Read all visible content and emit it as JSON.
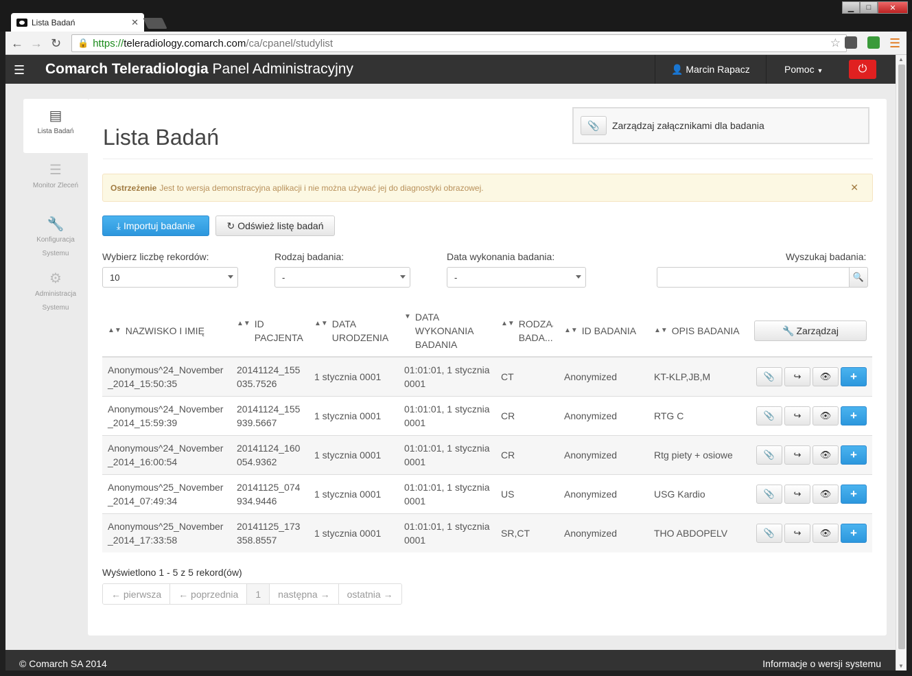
{
  "browser": {
    "tab_title": "Lista Badań",
    "url_protocol": "https://",
    "url_host": "teleradiology.comarch.com",
    "url_path": "/ca/cpanel/studylist"
  },
  "appbar": {
    "brand_bold": "Comarch Teleradiologia",
    "brand_rest": " Panel Administracyjny",
    "user_name": "Marcin Rapacz",
    "help_label": "Pomoc"
  },
  "sidenav": [
    {
      "label": "Lista Badań",
      "icon": "list-icon"
    },
    {
      "label": "Monitor Zleceń",
      "icon": "monitor-icon"
    },
    {
      "label": "Konfiguracja Systemu",
      "icon": "wrench-icon"
    },
    {
      "label": "Administracja Systemu",
      "icon": "gear-icon"
    }
  ],
  "page": {
    "title": "Lista Badań",
    "attach_label": "Zarządzaj załącznikami dla badania",
    "alert_strong": "Ostrzeżenie",
    "alert_text": "Jest to wersja demonstracyjna aplikacji i nie można używać jej do diagnostyki obrazowej.",
    "import_label": "Importuj badanie",
    "refresh_label": "Odśwież listę badań"
  },
  "filters": {
    "records_label": "Wybierz liczbę rekordów:",
    "records_value": "10",
    "type_label": "Rodzaj badania:",
    "type_value": "-",
    "date_label": "Data wykonania badania:",
    "date_value": "-",
    "search_label": "Wyszukaj badania:"
  },
  "table": {
    "headers": [
      "NAZWISKO I IMIĘ",
      "ID PACJENTA",
      "DATA URODZENIA",
      "DATA WYKONANIA BADANIA",
      "RODZAJ BADA...",
      "ID BADANIA",
      "OPIS BADANIA"
    ],
    "manage_label": "Zarządzaj",
    "rows": [
      {
        "name": "Anonymous^24_November_2014_15:50:35",
        "pid": "20141124_155035.7526",
        "dob": "1 stycznia 0001",
        "date": "01:01:01, 1 stycznia 0001",
        "type": "CT",
        "sid": "Anonymized",
        "desc": "KT-KLP,JB,M"
      },
      {
        "name": "Anonymous^24_November_2014_15:59:39",
        "pid": "20141124_155939.5667",
        "dob": "1 stycznia 0001",
        "date": "01:01:01, 1 stycznia 0001",
        "type": "CR",
        "sid": "Anonymized",
        "desc": "RTG C"
      },
      {
        "name": "Anonymous^24_November_2014_16:00:54",
        "pid": "20141124_160054.9362",
        "dob": "1 stycznia 0001",
        "date": "01:01:01, 1 stycznia 0001",
        "type": "CR",
        "sid": "Anonymized",
        "desc": "Rtg piety + osiowe"
      },
      {
        "name": "Anonymous^25_November_2014_07:49:34",
        "pid": "20141125_074934.9446",
        "dob": "1 stycznia 0001",
        "date": "01:01:01, 1 stycznia 0001",
        "type": "US",
        "sid": "Anonymized",
        "desc": "USG Kardio"
      },
      {
        "name": "Anonymous^25_November_2014_17:33:58",
        "pid": "20141125_173358.8557",
        "dob": "1 stycznia 0001",
        "date": "01:01:01, 1 stycznia 0001",
        "type": "SR,CT",
        "sid": "Anonymized",
        "desc": "THO ABDOPELV"
      }
    ]
  },
  "pagination": {
    "summary": "Wyświetlono 1 - 5 z 5 rekord(ów)",
    "first": "← pierwsza",
    "prev": "← poprzednia",
    "current": "1",
    "next": "następna →",
    "last": "ostatnia →"
  },
  "footer": {
    "copyright": "© Comarch SA 2014",
    "version_link": "Informacje o wersji systemu"
  }
}
